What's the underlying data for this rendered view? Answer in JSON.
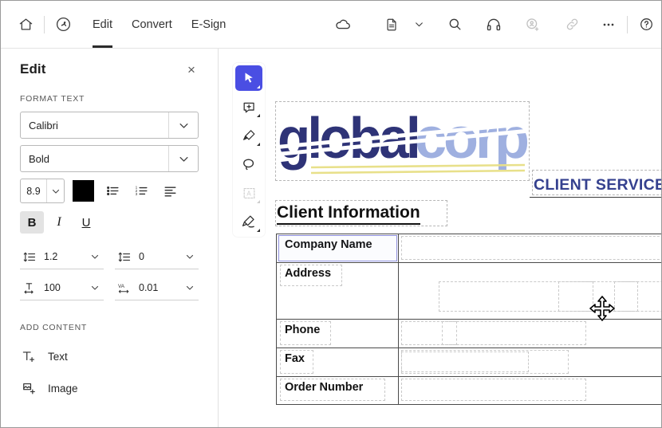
{
  "toolbar": {
    "home_icon": "home-icon",
    "app_icon": "acrobat-logo-icon",
    "tabs": [
      {
        "label": "Edit",
        "active": true
      },
      {
        "label": "Convert",
        "active": false
      },
      {
        "label": "E-Sign",
        "active": false
      }
    ],
    "cloud_icon": "cloud-icon",
    "document_icon": "document-icon",
    "document_caret": "chevron-down-icon",
    "search_icon": "search-icon",
    "support_icon": "headphones-icon",
    "add_person_icon": "add-person-icon",
    "link_icon": "link-icon",
    "more_icon": "ellipsis-icon",
    "help_icon": "help-icon"
  },
  "panel": {
    "title": "Edit",
    "close_label": "×",
    "format_section": "FORMAT TEXT",
    "font_family": "Calibri",
    "font_style": "Bold",
    "font_size": "8.9",
    "color_hex": "#000000",
    "bullet_list_icon": "bulleted-list-icon",
    "numbered_list_icon": "numbered-list-icon",
    "align_icon": "text-align-icon",
    "bold_label": "B",
    "italic_label": "I",
    "underline_label": "U",
    "bold_active": true,
    "line_spacing": "1.2",
    "paragraph_spacing": "0",
    "horizontal_scale": "100",
    "character_spacing": "0.01",
    "add_section": "ADD CONTENT",
    "add_items": [
      {
        "label": "Text",
        "icon": "add-text-icon"
      },
      {
        "label": "Image",
        "icon": "add-image-icon"
      }
    ]
  },
  "vertical_tools": [
    {
      "name": "select-tool",
      "active": true,
      "disabled": false
    },
    {
      "name": "comment-tool",
      "active": false,
      "disabled": false
    },
    {
      "name": "highlight-tool",
      "active": false,
      "disabled": false
    },
    {
      "name": "lasso-tool",
      "active": false,
      "disabled": false
    },
    {
      "name": "text-field-tool",
      "active": false,
      "disabled": true
    },
    {
      "name": "signature-tool",
      "active": false,
      "disabled": false
    }
  ],
  "document": {
    "logo": {
      "text_primary": "global",
      "text_secondary": "corp",
      "color_primary": "#2e3377",
      "color_secondary": "#9fb0e0",
      "accent_color": "#e8e08a"
    },
    "client_service_heading": "CLIENT SERVICE",
    "section_heading": "Client Information",
    "table_rows": [
      {
        "label": "Company Name",
        "value": "",
        "selected": true
      },
      {
        "label": "Address",
        "value": "",
        "selected": false
      },
      {
        "label": "Phone",
        "value": "",
        "selected": false
      },
      {
        "label": "Fax",
        "value": "",
        "selected": false
      },
      {
        "label": "Order Number",
        "value": "",
        "selected": false
      }
    ]
  },
  "cursor": {
    "type": "move-cursor"
  }
}
